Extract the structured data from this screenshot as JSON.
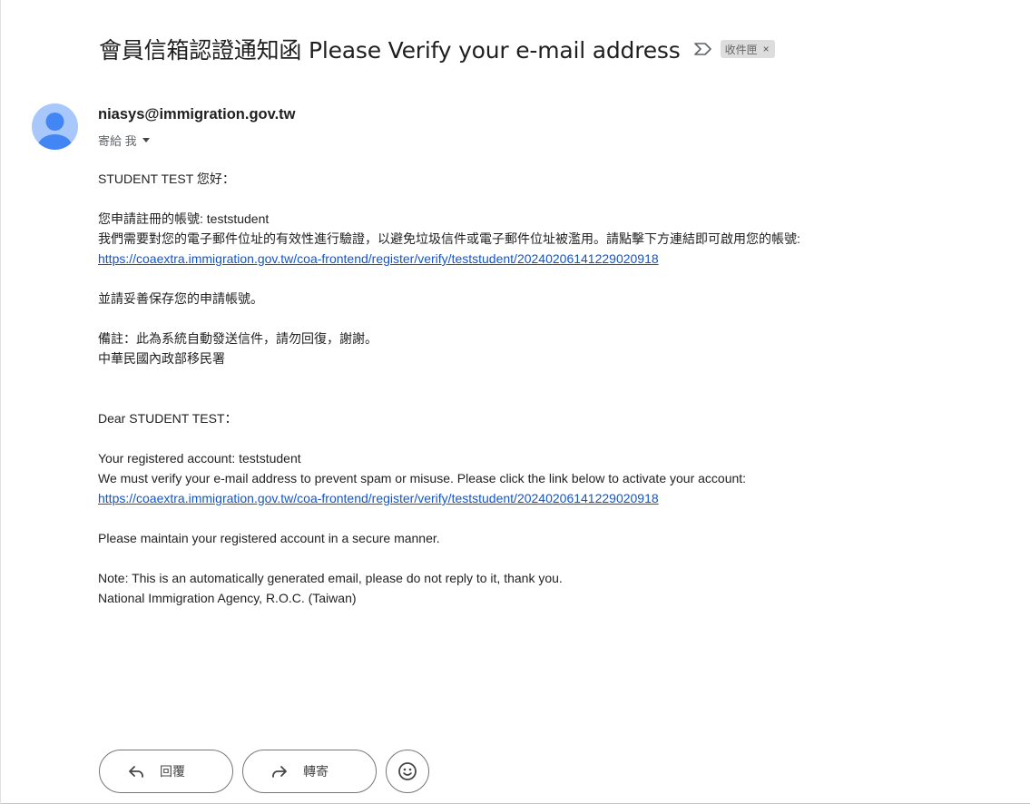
{
  "message": {
    "subject": "會員信箱認證通知函 Please Verify your e-mail address",
    "label": "收件匣",
    "label_remove": "×",
    "sender": "niasys@immigration.gov.tw",
    "recipient": "寄給 我"
  },
  "body": {
    "zh_greeting": "STUDENT TEST 您好：",
    "zh_account": "您申請註冊的帳號: teststudent",
    "zh_instruction": "我們需要對您的電子郵件位址的有效性進行驗證，以避免垃圾信件或電子郵件位址被濫用。請點擊下方連結即可啟用您的帳號:",
    "zh_link": "https://coaextra.immigration.gov.tw/coa-frontend/register/verify/teststudent/20240206141229020918",
    "zh_keep": "並請妥善保存您的申請帳號。",
    "zh_note": "備註：此為系統自動發送信件，請勿回復，謝謝。",
    "zh_org": "中華民國內政部移民署",
    "en_greeting": "Dear STUDENT TEST：",
    "en_account": "Your registered account: teststudent",
    "en_instruction": "We must verify your e-mail address to prevent spam or misuse. Please click the link below to activate your account:",
    "en_link": "https://coaextra.immigration.gov.tw/coa-frontend/register/verify/teststudent/20240206141229020918",
    "en_keep": "Please maintain your registered account in a secure manner.",
    "en_note": "Note: This is an automatically generated email, please do not reply to it, thank you.",
    "en_org": "National Immigration Agency, R.O.C. (Taiwan)"
  },
  "actions": {
    "reply_label": "回覆",
    "forward_label": "轉寄"
  },
  "icons": {
    "important": "importance-marker-icon",
    "reply": "reply-arrow-icon",
    "forward": "forward-arrow-icon",
    "emoji": "smiley-face-icon",
    "avatar": "person-avatar-icon"
  },
  "colors": {
    "link": "#1155cc",
    "avatar_bg": "#a8c7fa",
    "avatar_fg": "#4285f4",
    "chip_bg": "#dddddd"
  }
}
